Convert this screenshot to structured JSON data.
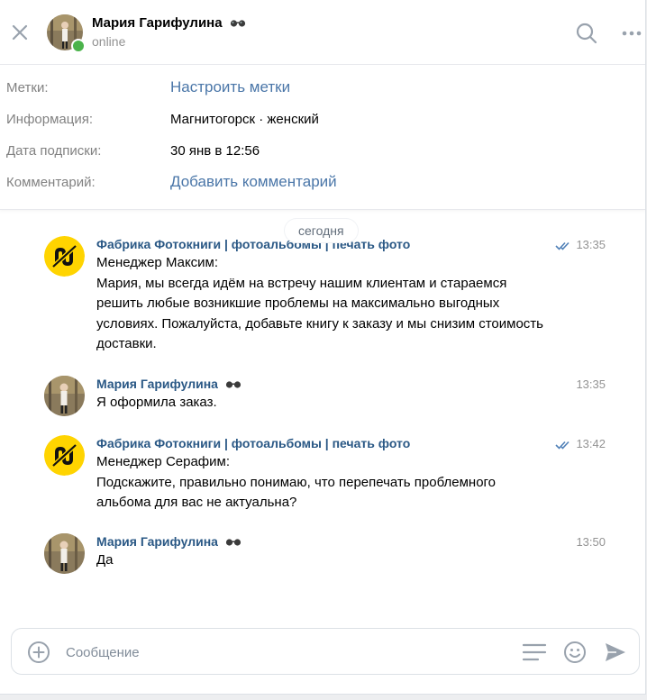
{
  "header": {
    "name": "Мария Гарифулина",
    "status": "online"
  },
  "info": {
    "rows": [
      {
        "label": "Метки:",
        "value": "Настроить метки"
      },
      {
        "label": "Информация:",
        "value": "Магнитогорск · женский"
      },
      {
        "label": "Дата подписки:",
        "value": "30 янв в 12:56"
      },
      {
        "label": "Комментарий:",
        "value": "Добавить комментарий"
      }
    ]
  },
  "date_separator": "сегодня",
  "messages": [
    {
      "author": "Фабрика Фотокниги | фотоальбомы | печать фото",
      "time": "13:35",
      "text": "Менеджер Максим:\nМария, мы всегда идём на встречу нашим клиентам и стараемся решить любые возникшие проблемы на максимально выгодных условиях. Пожалуйста, добавьте книгу к заказу и мы снизим стоимость доставки."
    },
    {
      "author": "Мария Гарифулина",
      "time": "13:35",
      "text": "Я оформила заказ."
    },
    {
      "author": "Фабрика Фотокниги | фотоальбомы | печать фото",
      "time": "13:42",
      "text": "Менеджер Серафим:\nПодскажите, правильно понимаю, что перепечать проблемного альбома для вас не актуальна?"
    },
    {
      "author": "Мария Гарифулина",
      "time": "13:50",
      "text": "Да"
    }
  ],
  "composer": {
    "placeholder": "Сообщение"
  },
  "colors": {
    "accent": "#4a76a8",
    "author": "#2a5885",
    "online": "#4bb34b",
    "read_check": "#5181b8",
    "brand_logo": "#ffd400"
  },
  "icons": [
    "close-icon",
    "search-icon",
    "more-icon",
    "glasses-emoji-icon",
    "read-checkmark-icon",
    "plus-circle-icon",
    "templates-icon",
    "emoji-icon",
    "send-icon",
    "brand-logo-icon"
  ]
}
